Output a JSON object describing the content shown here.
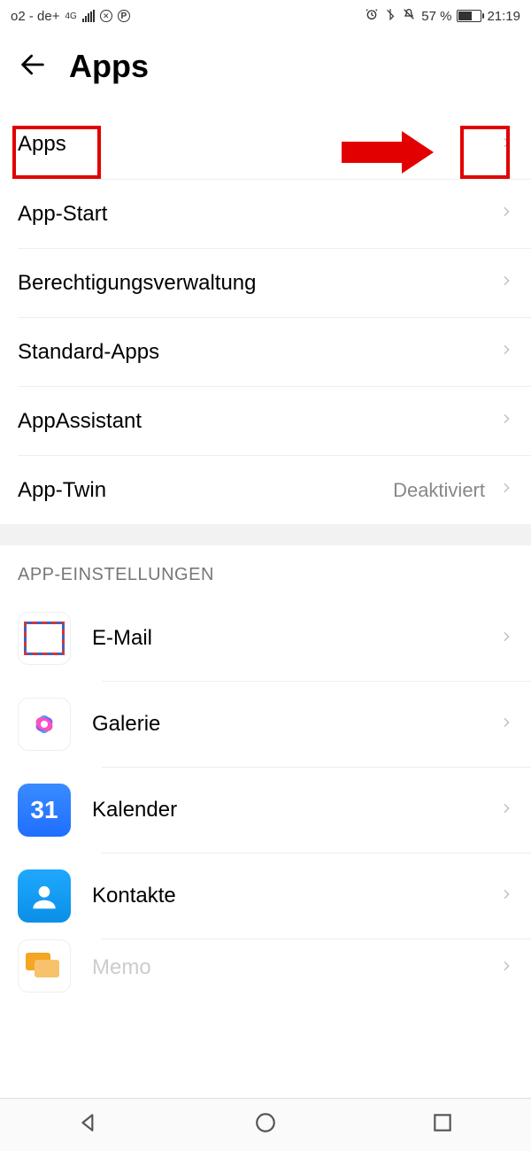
{
  "statusbar": {
    "carrier": "o2 - de+",
    "network": "4G",
    "battery_pct": "57 %",
    "time": "21:19"
  },
  "header": {
    "title": "Apps"
  },
  "menu": [
    {
      "label": "Apps",
      "value": ""
    },
    {
      "label": "App-Start",
      "value": ""
    },
    {
      "label": "Berechtigungsverwaltung",
      "value": ""
    },
    {
      "label": "Standard-Apps",
      "value": ""
    },
    {
      "label": "AppAssistant",
      "value": ""
    },
    {
      "label": "App-Twin",
      "value": "Deaktiviert"
    }
  ],
  "section_header": "APP-EINSTELLUNGEN",
  "apps": [
    {
      "label": "E-Mail"
    },
    {
      "label": "Galerie"
    },
    {
      "label": "Kalender",
      "badge": "31"
    },
    {
      "label": "Kontakte"
    },
    {
      "label": "Memo"
    }
  ]
}
